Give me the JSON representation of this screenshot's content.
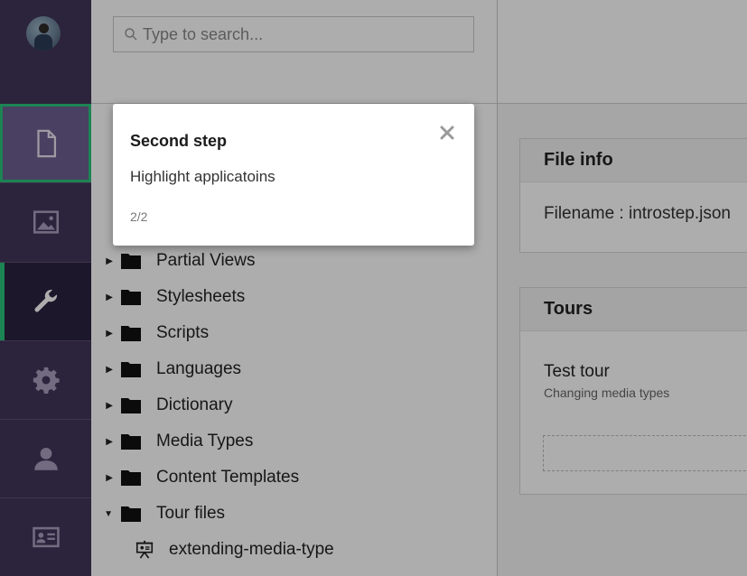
{
  "search": {
    "placeholder": "Type to search..."
  },
  "sidebar": {
    "items": [
      {
        "name": "content",
        "icon": "document-icon",
        "active": false,
        "highlighted": true
      },
      {
        "name": "media",
        "icon": "image-icon"
      },
      {
        "name": "settings",
        "icon": "wrench-icon",
        "active": true
      },
      {
        "name": "developer",
        "icon": "gear-icon"
      },
      {
        "name": "users",
        "icon": "user-icon"
      },
      {
        "name": "members",
        "icon": "id-card-icon"
      }
    ]
  },
  "tree": {
    "items": [
      {
        "label": "Partial Views",
        "expanded": false
      },
      {
        "label": "Stylesheets",
        "expanded": false
      },
      {
        "label": "Scripts",
        "expanded": false
      },
      {
        "label": "Languages",
        "expanded": false
      },
      {
        "label": "Dictionary",
        "expanded": false
      },
      {
        "label": "Media Types",
        "expanded": false
      },
      {
        "label": "Content Templates",
        "expanded": false
      },
      {
        "label": "Tour files",
        "expanded": true
      }
    ],
    "file": {
      "label": "extending-media-type",
      "icon": "presentation-icon"
    }
  },
  "fileinfo": {
    "title": "File info",
    "filename": "Filename : introstep.json"
  },
  "tours": {
    "title": "Tours",
    "tour_name": "Test tour",
    "tour_desc": "Changing media types"
  },
  "popup": {
    "title": "Second step",
    "body": "Highlight applicatoins",
    "step": "2/2",
    "close_icon": "close-icon"
  },
  "colors": {
    "sidebar": "#413659",
    "accent": "#2bc37c",
    "overlay": "rgba(0,0,0,0.32)"
  }
}
